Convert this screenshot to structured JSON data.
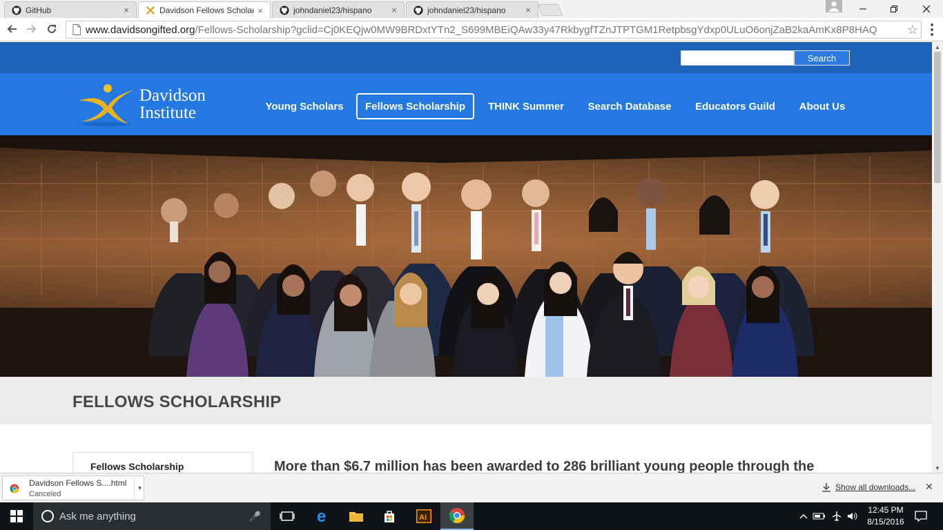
{
  "browser": {
    "tabs": [
      {
        "title": "GitHub",
        "icon": "github-icon",
        "close": "×"
      },
      {
        "title": "Davidson Fellows Scholarship",
        "icon": "davidson-favicon",
        "close": "×"
      },
      {
        "title": "johndaniel23/hispano",
        "icon": "github-icon",
        "close": "×"
      },
      {
        "title": "johndaniel23/hispano",
        "icon": "github-icon",
        "close": "×"
      }
    ],
    "url_host": "www.davidsongifted.org",
    "url_path": "/Fellows-Scholarship?gclid=Cj0KEQjw0MW9BRDxtYTn2_S699MBEiQAw33y47RkbygfTZnJTPTGM1RetpbsgYdxp0ULuO6onjZaB2kaAmKx8P8HAQ"
  },
  "site": {
    "search_button": "Search",
    "logo": {
      "line1": "Davidson",
      "line2": "Institute"
    },
    "nav": [
      {
        "label": "Young Scholars"
      },
      {
        "label": "Fellows Scholarship",
        "active": true
      },
      {
        "label": "THINK Summer"
      },
      {
        "label": "Search Database"
      },
      {
        "label": "Educators Guild"
      },
      {
        "label": "About Us"
      }
    ],
    "page_title": "FELLOWS SCHOLARSHIP",
    "sidebar_item": "Fellows Scholarship",
    "lead_text": "More than $6.7 million has been awarded to 286 brilliant young people through the"
  },
  "downloads": {
    "item_name": "Davidson Fellows S....html",
    "item_status": "Canceled",
    "show_all": "Show all downloads..."
  },
  "taskbar": {
    "search_placeholder": "Ask me anything",
    "time": "12:45 PM",
    "date": "8/15/2016"
  },
  "colors": {
    "topbar": "#1d62b8",
    "navbar": "#2378e2",
    "logo_gold": "#e9b21e"
  }
}
